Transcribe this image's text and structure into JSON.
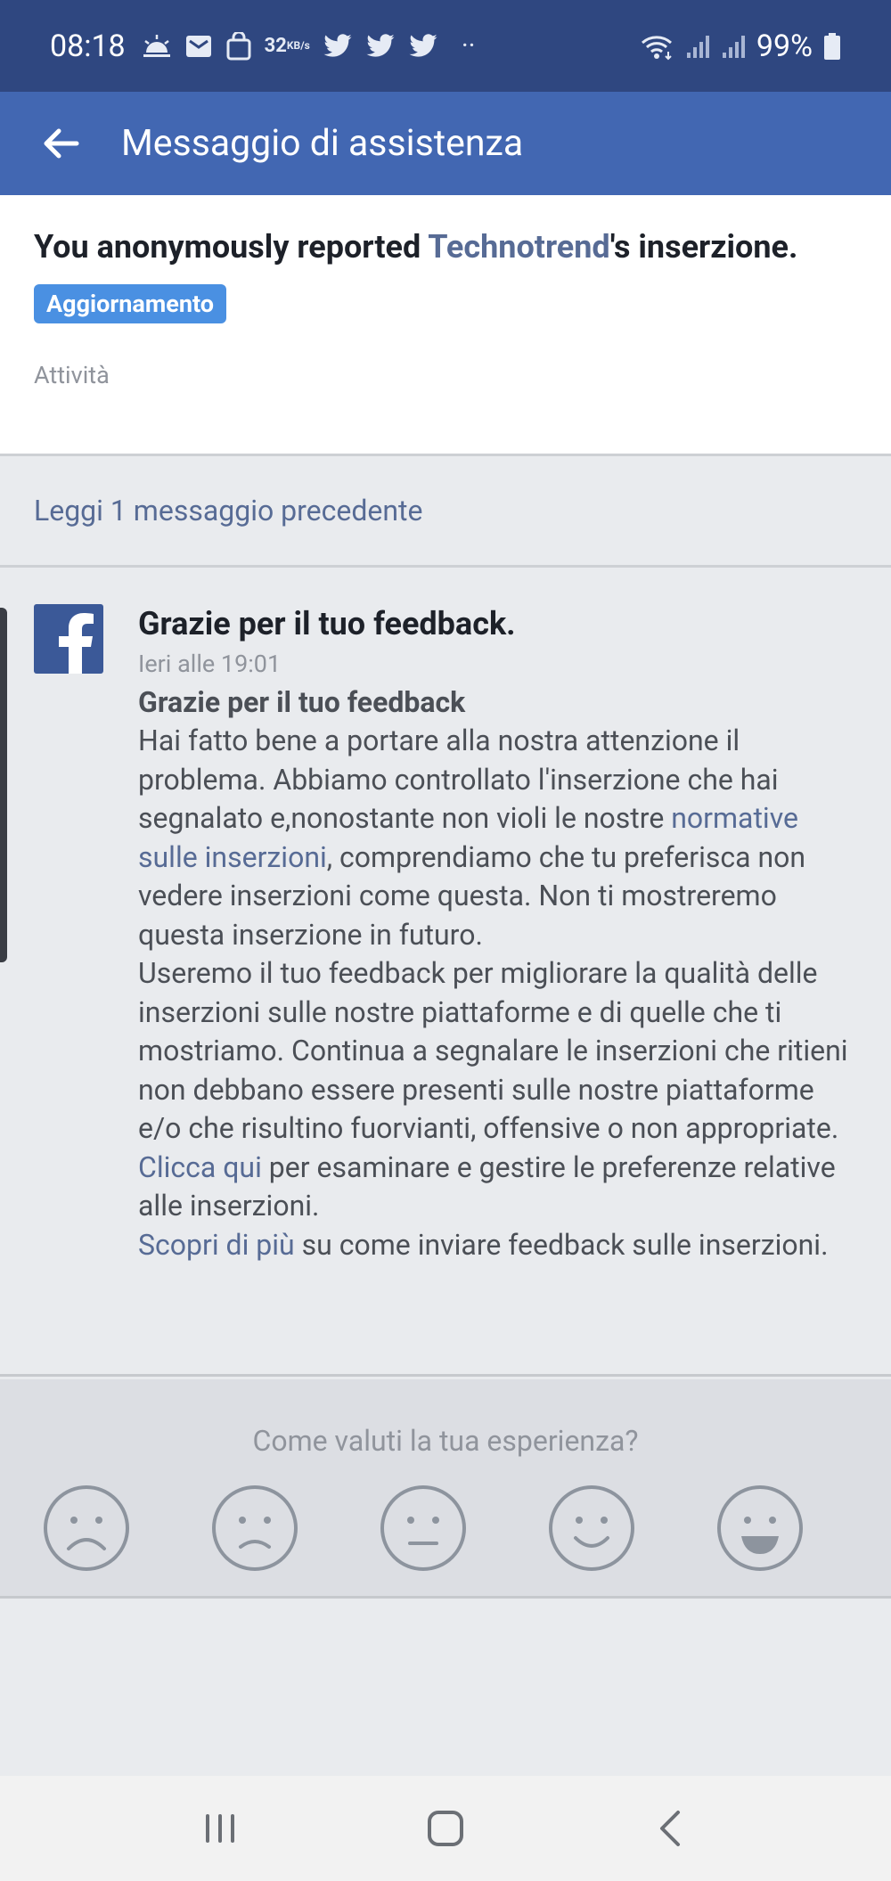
{
  "statusbar": {
    "time": "08:18",
    "net_speed_value": "32",
    "net_speed_unit": "KB/s",
    "dots": "··",
    "battery": "99%"
  },
  "appbar": {
    "title": "Messaggio di assistenza"
  },
  "header": {
    "title_prefix": "You anonymously reported ",
    "title_name": "Technotrend",
    "title_suffix": "'s inserzione.",
    "badge": "Aggiornamento",
    "activity_label": "Attività"
  },
  "older_messages": {
    "label": "Leggi 1 messaggio precedente"
  },
  "message": {
    "title": "Grazie per il tuo feedback.",
    "time": "Ieri alle 19:01",
    "subtitle": "Grazie per il tuo feedback",
    "p1_before": "Hai fatto bene a portare alla nostra attenzione il problema. Abbiamo controllato l'inserzione che hai segnalato e,nonostante non violi le nostre ",
    "p1_link": "normative sulle inserzioni",
    "p1_after": ", comprendiamo che tu preferisca non vedere inserzioni come questa. Non ti mostreremo questa inserzione in futuro.",
    "p2": "Useremo il tuo feedback per migliorare la qualità delle inserzioni sulle nostre piattaforme e di quelle che ti mostriamo. Continua a segnalare le inserzioni che ritieni non debbano essere presenti sulle nostre piattaforme e/o che risultino fuorvianti, offensive o non appropriate.",
    "p3_link": "Clicca qui",
    "p3_after": " per esaminare e gestire le preferenze relative alle inserzioni.",
    "p4_link": "Scopri di più",
    "p4_after": " su come inviare feedback sulle inserzioni."
  },
  "rating": {
    "question": "Come valuti la tua esperienza?",
    "faces": [
      "very-sad-face-icon",
      "sad-face-icon",
      "neutral-face-icon",
      "smile-face-icon",
      "big-smile-face-icon"
    ]
  },
  "colors": {
    "statusbar": "#2f4780",
    "appbar": "#4267b2",
    "link": "#576b95",
    "badge": "#4a90e2",
    "facebook": "#3b5998"
  }
}
